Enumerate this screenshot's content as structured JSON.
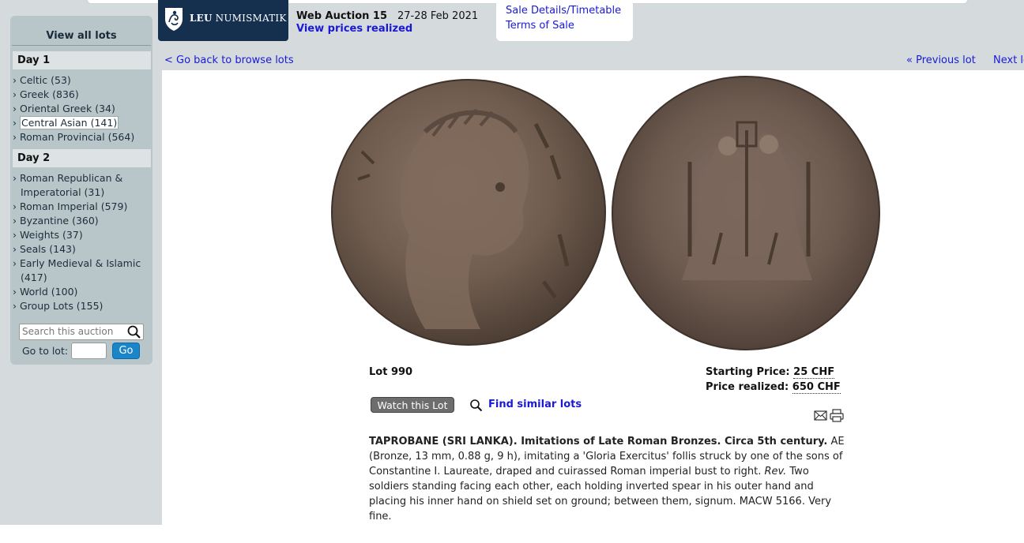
{
  "header": {
    "logo_text_bold": "LEU",
    "logo_text_rest": " NUMISMATIK",
    "auction_title": "Web Auction 15",
    "auction_dates": "27-28 Feb 2021",
    "view_prices_label": "View prices realized",
    "links": [
      "Sale Details/Timetable",
      "Terms of Sale"
    ]
  },
  "sidebar": {
    "view_all": "View all lots",
    "days": [
      {
        "label": "Day 1",
        "items": [
          {
            "label": "Celtic (53)"
          },
          {
            "label": "Greek (836)"
          },
          {
            "label": "Oriental Greek (34)"
          },
          {
            "label": "Central Asian (141)",
            "selected": true
          },
          {
            "label": "Roman Provincial (564)"
          }
        ]
      },
      {
        "label": "Day 2",
        "items": [
          {
            "label": "Roman Republican &",
            "label2": "Imperatorial (31)"
          },
          {
            "label": "Roman Imperial (579)"
          },
          {
            "label": "Byzantine (360)"
          },
          {
            "label": "Weights (37)"
          },
          {
            "label": "Seals (143)"
          },
          {
            "label": "Early Medieval & Islamic",
            "label2": "(417)"
          },
          {
            "label": "World (100)"
          },
          {
            "label": "Group Lots (155)"
          }
        ]
      }
    ],
    "search_placeholder": "Search this auction",
    "goto_label": "Go to lot:",
    "go_button": "Go",
    "arrow": "›"
  },
  "nav": {
    "back": "< Go back to browse lots",
    "prev": "« Previous lot",
    "next": "Next lot »"
  },
  "lot": {
    "number": "Lot 990",
    "starting_price_label": "Starting Price:",
    "starting_price": "25 CHF",
    "realized_label": "Price realized:",
    "realized": "650 CHF",
    "watch_button": "Watch this Lot",
    "find_similar": "Find similar lots",
    "title_bold": "TAPROBANE (SRI LANKA). Imitations of Late Roman Bronzes. Circa 5th century.",
    "desc_1": " AE (Bronze, 13 mm, 0.88 g, 9 h), imitating a 'Gloria Exercitus' follis struck by one of the sons of Constantine I. Laureate, draped and cuirassed Roman imperial bust to right. ",
    "rev_label": "Rev.",
    "desc_2": " Two soldiers standing facing each other, each holding inverted spear in his outer hand and placing his inner hand on shield set on ground; between them, signum. MACW 5166. Very fine."
  },
  "colors": {
    "link": "#1a1ad6",
    "sidebar_bg": "#b8c6ca",
    "logo_bg": "#152f4f",
    "go_button": "#1a85c8",
    "coin_bronze": "#6f5c4f"
  },
  "icons": [
    "leu-shield-icon",
    "search-icon",
    "magnifier-icon",
    "mail-icon",
    "print-icon"
  ]
}
